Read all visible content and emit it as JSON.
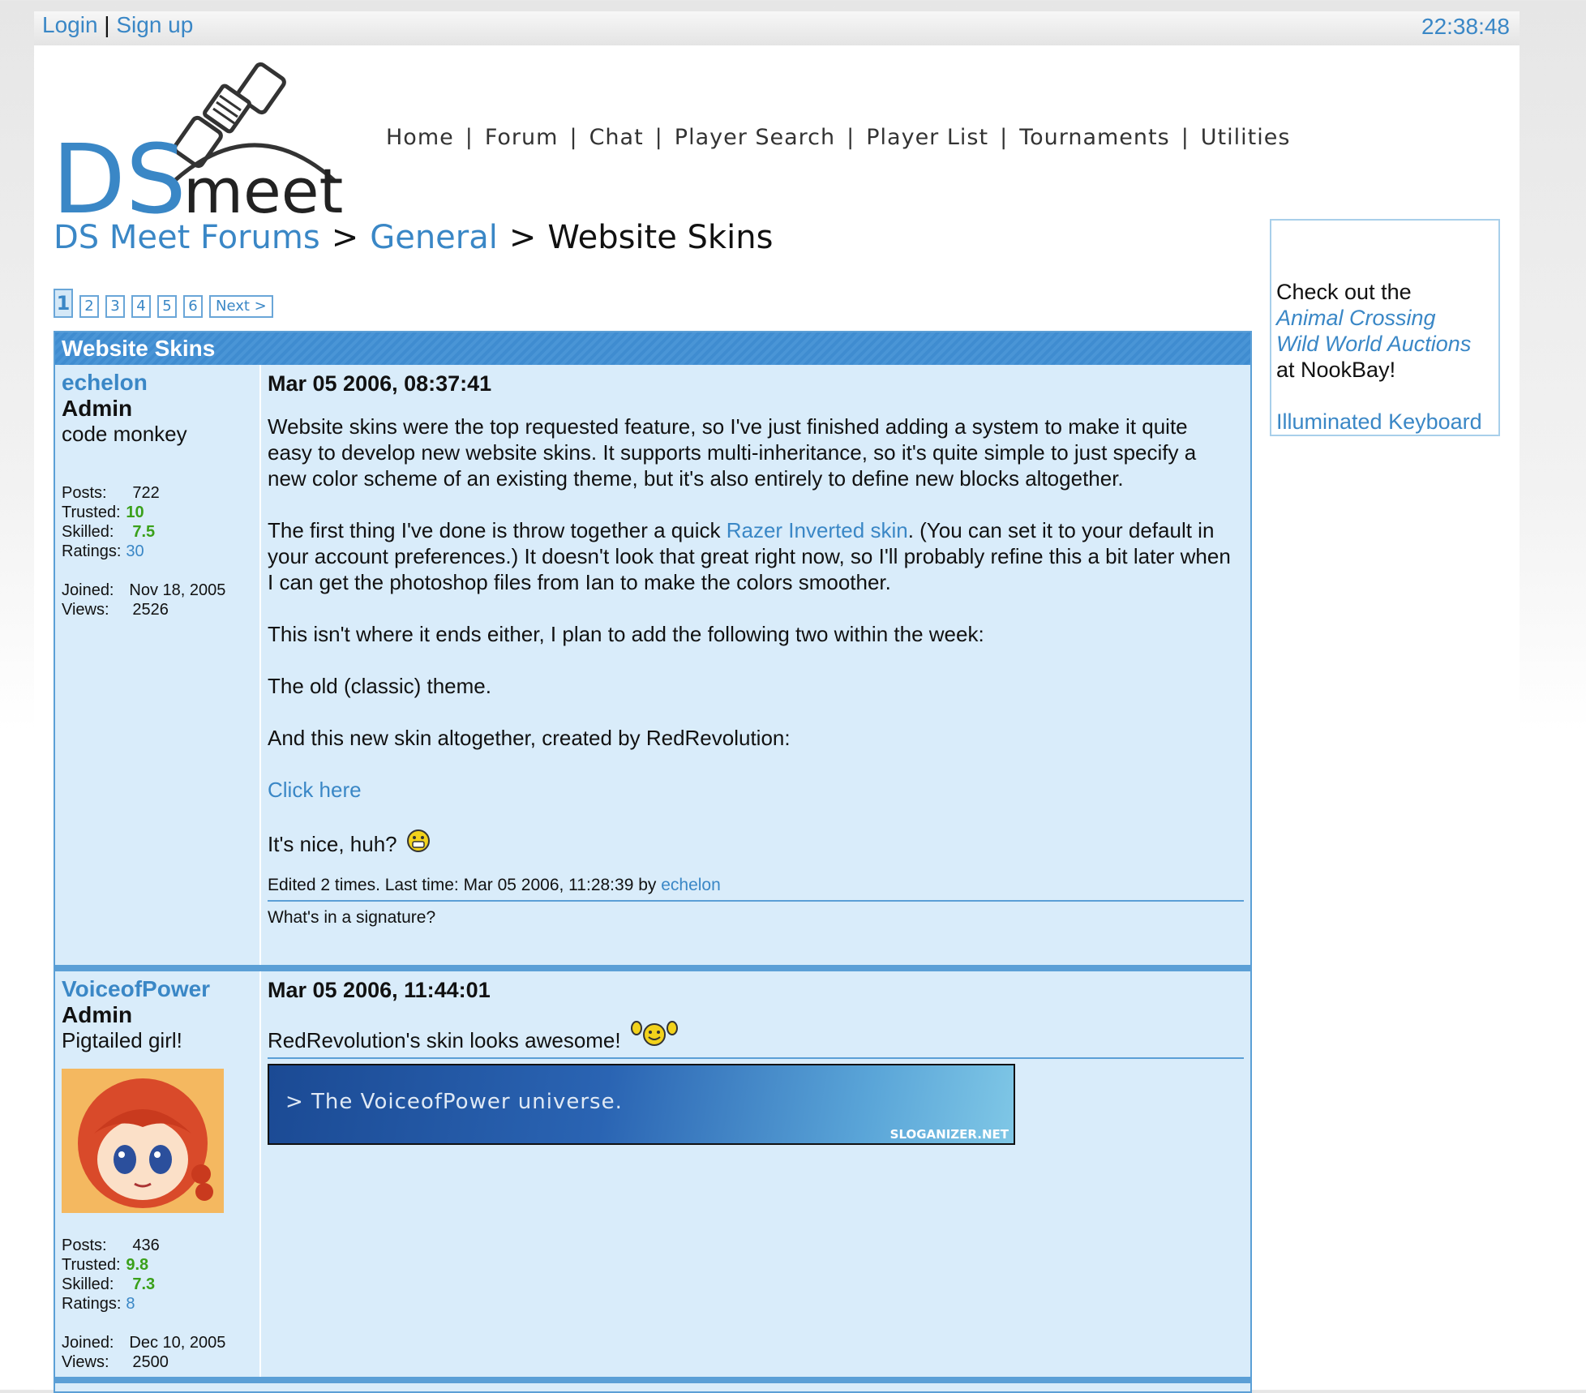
{
  "topbar": {
    "login": "Login",
    "divider": "|",
    "signup": "Sign up",
    "clock": "22:38:48"
  },
  "logo": {
    "text_ds": "DS",
    "text_meet": "meet"
  },
  "nav": {
    "items": [
      "Home",
      "Forum",
      "Chat",
      "Player Search",
      "Player List",
      "Tournaments",
      "Utilities"
    ],
    "separator": "|"
  },
  "breadcrumb": {
    "root": "DS Meet Forums",
    "section": "General",
    "current": "Website Skins",
    "separator": ">"
  },
  "pager": {
    "pages": [
      "1",
      "2",
      "3",
      "4",
      "5",
      "6"
    ],
    "current": "1",
    "next": "Next >"
  },
  "ad": {
    "line1": "Check out the",
    "link1a": "Animal Crossing",
    "link1b": "Wild World Auctions",
    "line2": "at NookBay!",
    "link2": "Illuminated Keyboard"
  },
  "thread": {
    "title": "Website Skins",
    "posts": [
      {
        "username": "echelon",
        "rank": "Admin",
        "user_title": "code monkey",
        "stats": {
          "posts_label": "Posts:",
          "posts": "722",
          "trusted_label": "Trusted:",
          "trusted": "10",
          "skilled_label": "Skilled:",
          "skilled": "7.5",
          "ratings_label": "Ratings:",
          "ratings": "30",
          "joined_label": "Joined:",
          "joined": "Nov 18, 2005",
          "views_label": "Views:",
          "views": "2526"
        },
        "time": "Mar 05 2006, 08:37:41",
        "p1": "Website skins were the top requested feature, so I've just finished adding a system to make it quite easy to develop new website skins. It supports multi-inheritance, so it's quite simple to just specify a new color scheme of an existing theme, but it's also entirely to define new blocks altogether.",
        "p2_before": "The first thing I've done is throw together a quick ",
        "p2_link": "Razer Inverted skin",
        "p2_after": ". (You can set it to your default in your account preferences.) It doesn't look that great right now, so I'll probably refine this a bit later when I can get the photoshop files from Ian to make the colors smoother.",
        "p3": "This isn't where it ends either, I plan to add the following two within the week:",
        "p4": "The old (classic) theme.",
        "p5": "And this new skin altogether, created by RedRevolution:",
        "p6_link": "Click here",
        "p7": "It's nice, huh?",
        "edited_prefix": "Edited 2 times. Last time: Mar 05 2006, 11:28:39 by ",
        "edited_by": "echelon",
        "signature": "What's in a signature?"
      },
      {
        "username": "VoiceofPower",
        "rank": "Admin",
        "user_title": "Pigtailed girl!",
        "stats": {
          "posts_label": "Posts:",
          "posts": "436",
          "trusted_label": "Trusted:",
          "trusted": "9.8",
          "skilled_label": "Skilled:",
          "skilled": "7.3",
          "ratings_label": "Ratings:",
          "ratings": "8",
          "joined_label": "Joined:",
          "joined": "Dec 10, 2005",
          "views_label": "Views:",
          "views": "2500"
        },
        "time": "Mar 05 2006, 11:44:01",
        "p1": "RedRevolution's skin looks awesome!",
        "banner_text": "> The VoiceofPower universe.",
        "banner_mark": "SLOGANIZER.NET"
      }
    ]
  },
  "colors": {
    "link": "#3a87c6",
    "accent": "#5b9fd6",
    "panel": "#d9ecfa",
    "good": "#3aa01a"
  }
}
